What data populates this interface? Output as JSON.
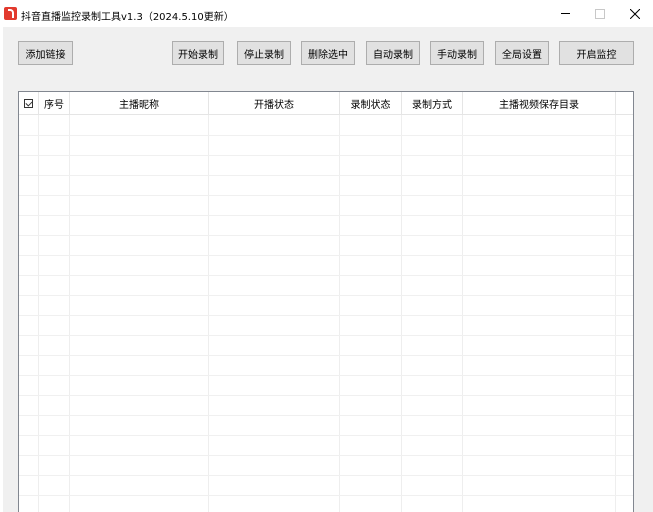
{
  "window": {
    "title": "抖音直播监控录制工具v1.3（2024.5.10更新）",
    "icon": "douyin-logo-icon",
    "controls": {
      "minimize": "minimize-icon",
      "maximize": "maximize-icon",
      "close": "close-icon"
    }
  },
  "toolbar": {
    "add_link": "添加链接",
    "start_record": "开始录制",
    "stop_record": "停止录制",
    "delete_selected": "删除选中",
    "auto_record": "自动录制",
    "manual_record": "手动录制",
    "global_settings": "全局设置",
    "start_monitor": "开启监控"
  },
  "table": {
    "select_all_checked": true,
    "columns": [
      "序号",
      "主播昵称",
      "开播状态",
      "录制状态",
      "录制方式",
      "主播视频保存目录"
    ],
    "rows": []
  },
  "colors": {
    "accent": "#e23a2e",
    "window_bg": "#f0f0f0",
    "button_bg": "#e1e1e1"
  }
}
